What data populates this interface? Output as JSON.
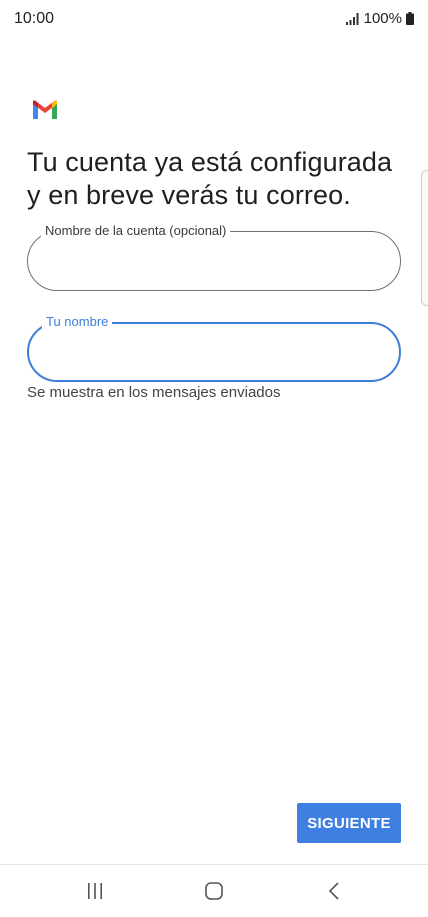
{
  "status_bar": {
    "time": "10:00",
    "battery": "100%"
  },
  "icons": {
    "logo": "gmail-logo",
    "signal": "signal-icon",
    "battery": "battery-icon",
    "recents": "recents-icon",
    "home": "home-icon",
    "back": "back-icon"
  },
  "page": {
    "title": "Tu cuenta ya está configurada y en breve verás tu correo."
  },
  "form": {
    "account_name": {
      "label": "Nombre de la cuenta (opcional)",
      "value": ""
    },
    "your_name": {
      "label": "Tu nombre",
      "value": "",
      "helper": "Se muestra en los mensajes enviados"
    }
  },
  "actions": {
    "next_label": "SIGUIENTE"
  },
  "colors": {
    "accent": "#3c7fd9",
    "button": "#3f7fe2",
    "gmail_red": "#ea4335",
    "gmail_blue": "#4285f4",
    "gmail_green": "#34a853",
    "gmail_yellow": "#fbbc04"
  }
}
